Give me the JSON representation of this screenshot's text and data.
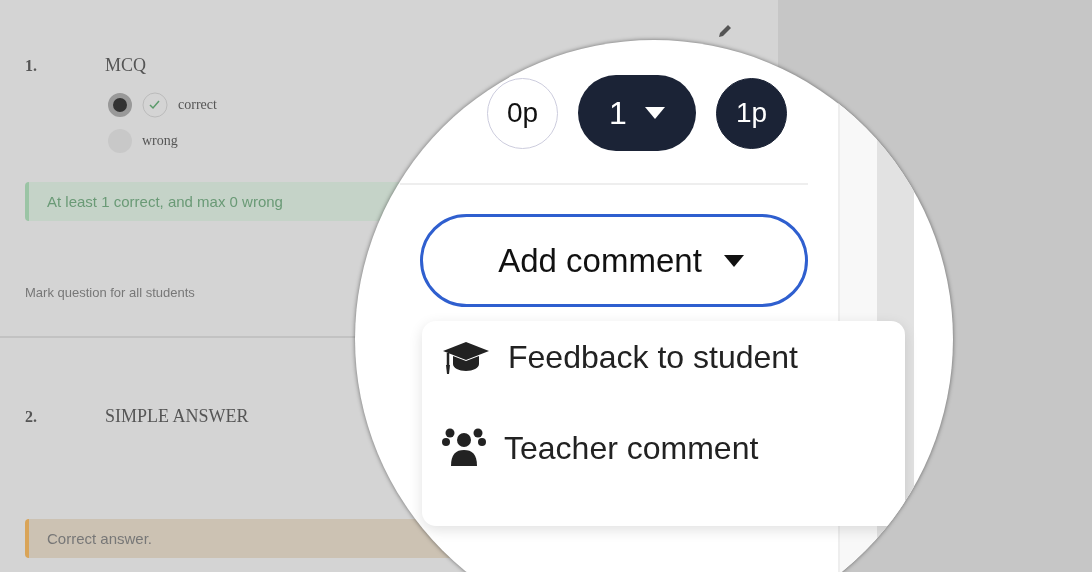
{
  "questions": [
    {
      "number": "1.",
      "title": "MCQ",
      "options": [
        {
          "label": "correct",
          "selected": true,
          "correct": true
        },
        {
          "label": "wrong",
          "selected": false,
          "correct": false
        }
      ],
      "feedback": {
        "kind": "success",
        "text": "At least 1 correct, and max 0 wrong"
      },
      "link": "Mark question for all students"
    },
    {
      "number": "2.",
      "title": "SIMPLE ANSWER",
      "feedback": {
        "kind": "warning",
        "text": "Correct answer."
      }
    }
  ],
  "points": [
    {
      "label": "0p",
      "selected": false
    },
    {
      "label": "1",
      "kind": "dropdown"
    },
    {
      "label": "1p",
      "selected": true
    }
  ],
  "add_comment": {
    "label": "Add comment",
    "expanded": true
  },
  "menu": [
    {
      "label": "Feedback to student",
      "kind": "student"
    },
    {
      "label": "Teacher comment",
      "kind": "teacher"
    }
  ]
}
